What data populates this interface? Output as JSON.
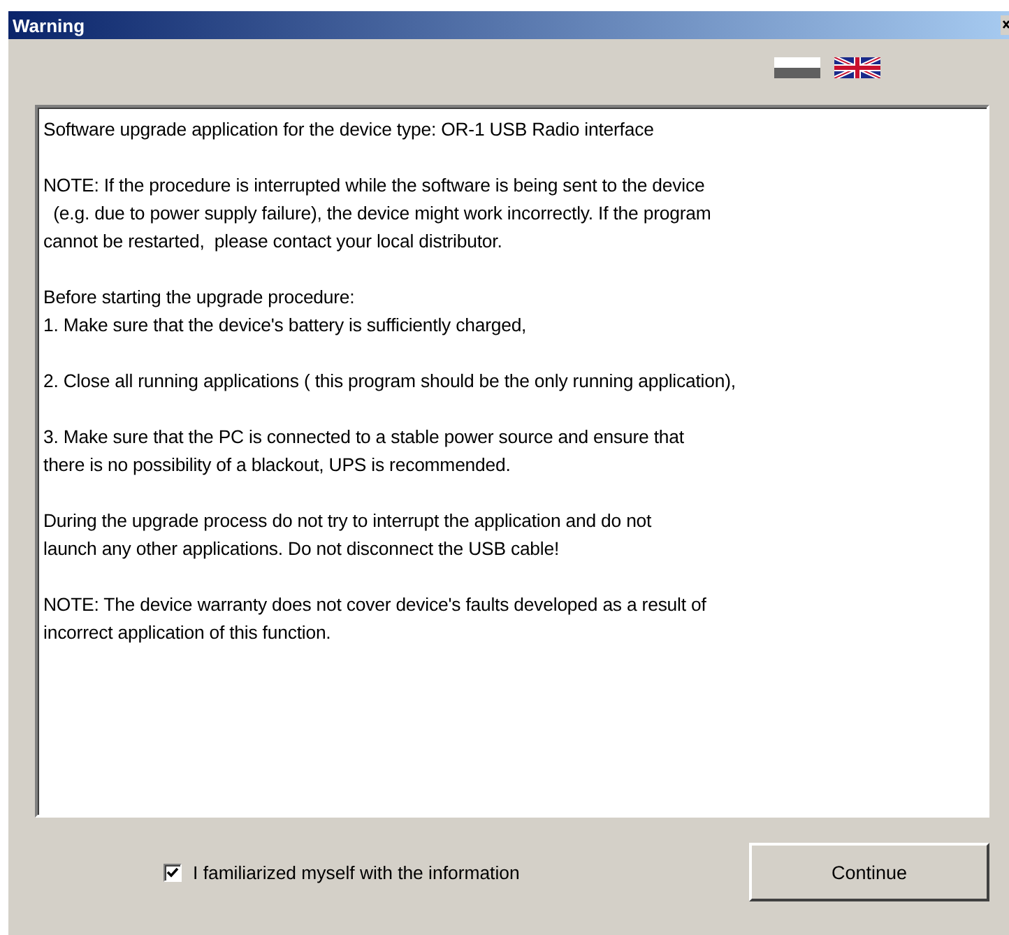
{
  "window": {
    "title": "Warning"
  },
  "message": [
    "Software upgrade application for the device type: OR-1 USB Radio interface",
    "NOTE: If the procedure is interrupted while the software is being sent to the device\n  (e.g. due to power supply failure), the device might work incorrectly. If the program\ncannot be restarted,  please contact your local distributor.",
    "Before starting the upgrade procedure:\n1. Make sure that the device's battery is sufficiently charged,",
    "2. Close all running applications ( this program should be the only running application),",
    "3. Make sure that the PC is connected to a stable power source and ensure that\nthere is no possibility of a blackout, UPS is recommended.",
    "During the upgrade process do not try to interrupt the application and do not\nlaunch any other applications. Do not disconnect the USB cable!",
    "NOTE: The device warranty does not cover device's faults developed as a result of\nincorrect application of this function."
  ],
  "confirm": {
    "label": "I familiarized myself with the information",
    "checked": true
  },
  "buttons": [
    "Continue"
  ]
}
